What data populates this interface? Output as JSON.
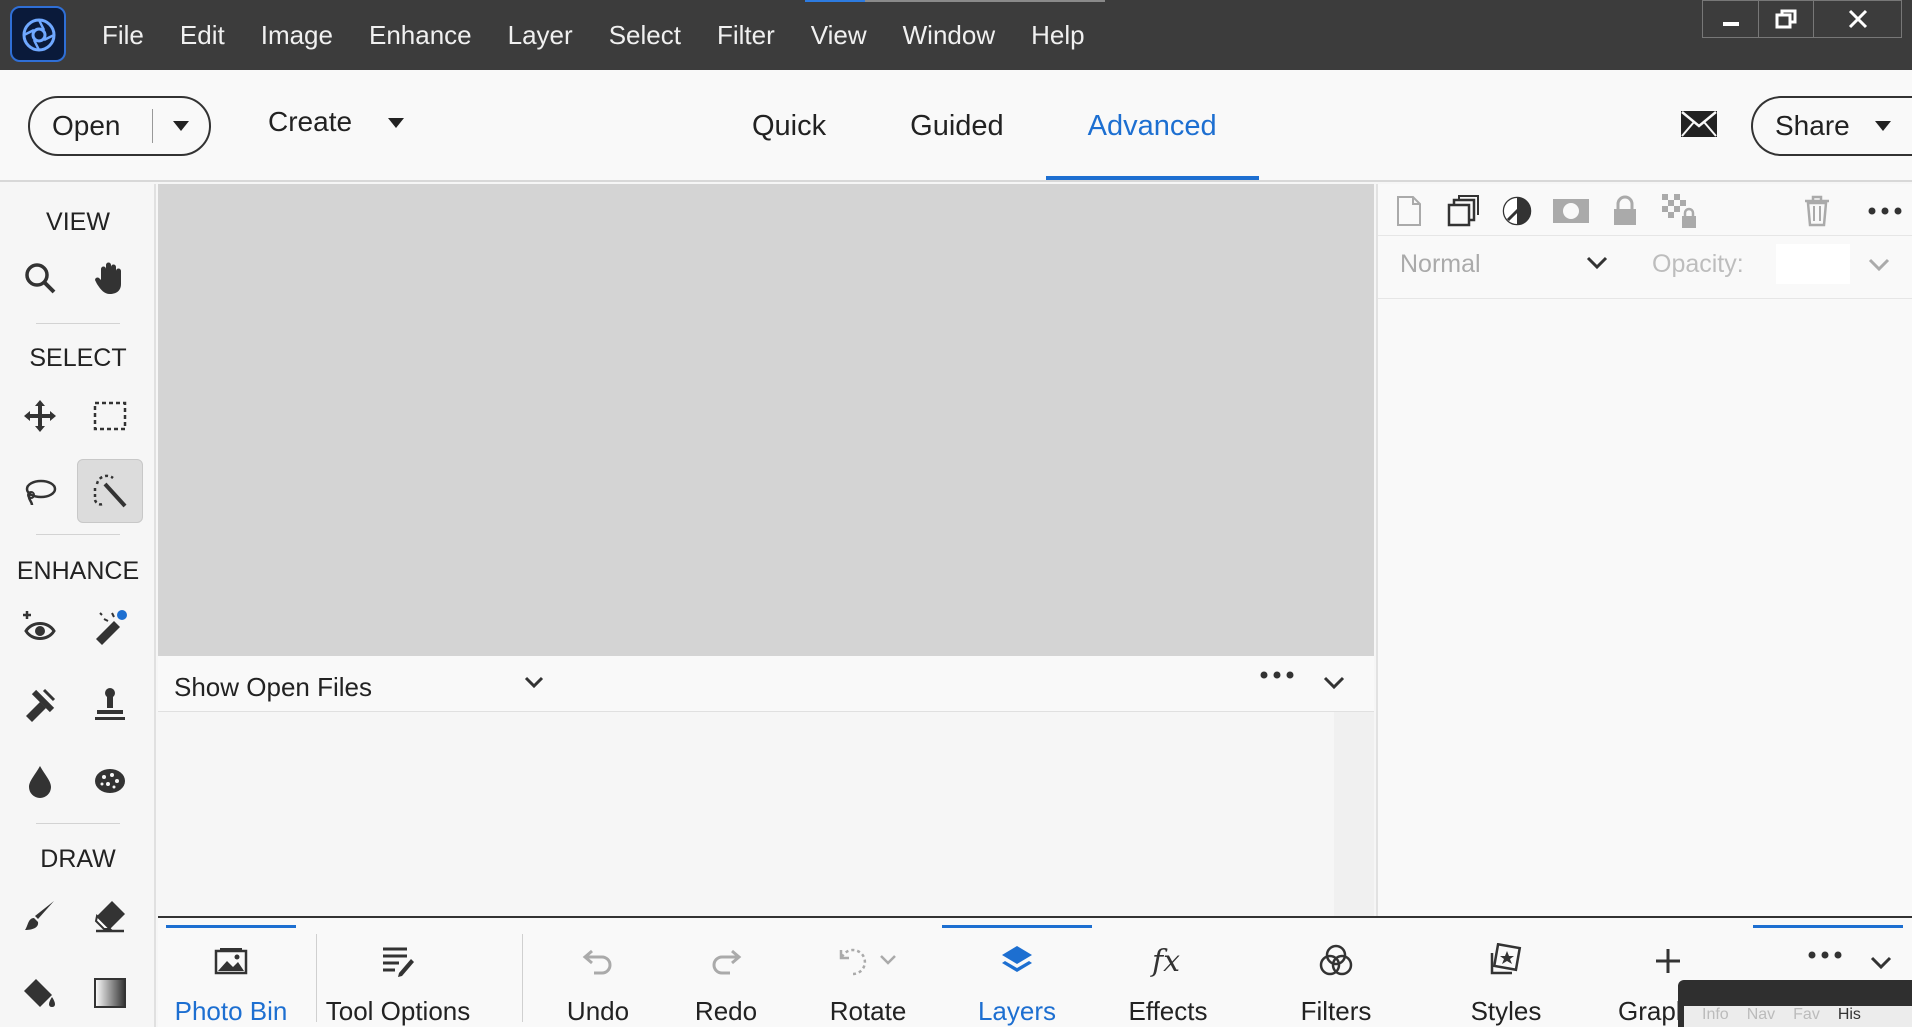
{
  "menubar": {
    "items": [
      "File",
      "Edit",
      "Image",
      "Enhance",
      "Layer",
      "Select",
      "Filter",
      "View",
      "Window",
      "Help"
    ],
    "window_controls": [
      "minimize-icon",
      "restore-icon",
      "close-icon"
    ]
  },
  "modebar": {
    "open_label": "Open",
    "create_label": "Create",
    "tabs": [
      "Quick",
      "Guided",
      "Advanced"
    ],
    "active_tab": "Advanced",
    "share_label": "Share"
  },
  "toolbox": {
    "sections": [
      "VIEW",
      "SELECT",
      "ENHANCE",
      "DRAW"
    ],
    "view_tools": [
      "zoom-icon",
      "hand-icon"
    ],
    "select_tools": [
      "move-icon",
      "marquee-icon",
      "lasso-icon",
      "quick-selection-icon"
    ],
    "enhance_tools": [
      "red-eye-icon",
      "spot-healing-icon",
      "smart-brush-icon",
      "clone-stamp-icon",
      "blur-icon",
      "sponge-icon"
    ],
    "draw_tools": [
      "brush-icon",
      "eraser-icon",
      "paint-bucket-icon",
      "gradient-icon"
    ]
  },
  "photo_bin": {
    "dropdown_label": "Show Open Files"
  },
  "layers_panel": {
    "blend_mode": "Normal",
    "opacity_label": "Opacity:",
    "opacity_value": ""
  },
  "bottombar": {
    "items": [
      {
        "label": "Photo Bin",
        "icon": "photo-bin-icon"
      },
      {
        "label": "Tool Options",
        "icon": "tool-options-icon"
      },
      {
        "label": "Undo",
        "icon": "undo-icon"
      },
      {
        "label": "Redo",
        "icon": "redo-icon"
      },
      {
        "label": "Rotate",
        "icon": "rotate-icon"
      },
      {
        "label": "Layers",
        "icon": "layers-icon"
      },
      {
        "label": "Effects",
        "icon": "effects-icon"
      },
      {
        "label": "Filters",
        "icon": "filters-icon"
      },
      {
        "label": "Styles",
        "icon": "styles-icon"
      },
      {
        "label": "Graphics",
        "icon": "add-icon"
      }
    ],
    "floating_tabs": [
      "Info",
      "Nav",
      "Fav",
      "His"
    ]
  },
  "colors": {
    "accent": "#1d6fd1",
    "menubar_bg": "#3c3c3c",
    "canvas_bg": "#d4d4d4"
  }
}
